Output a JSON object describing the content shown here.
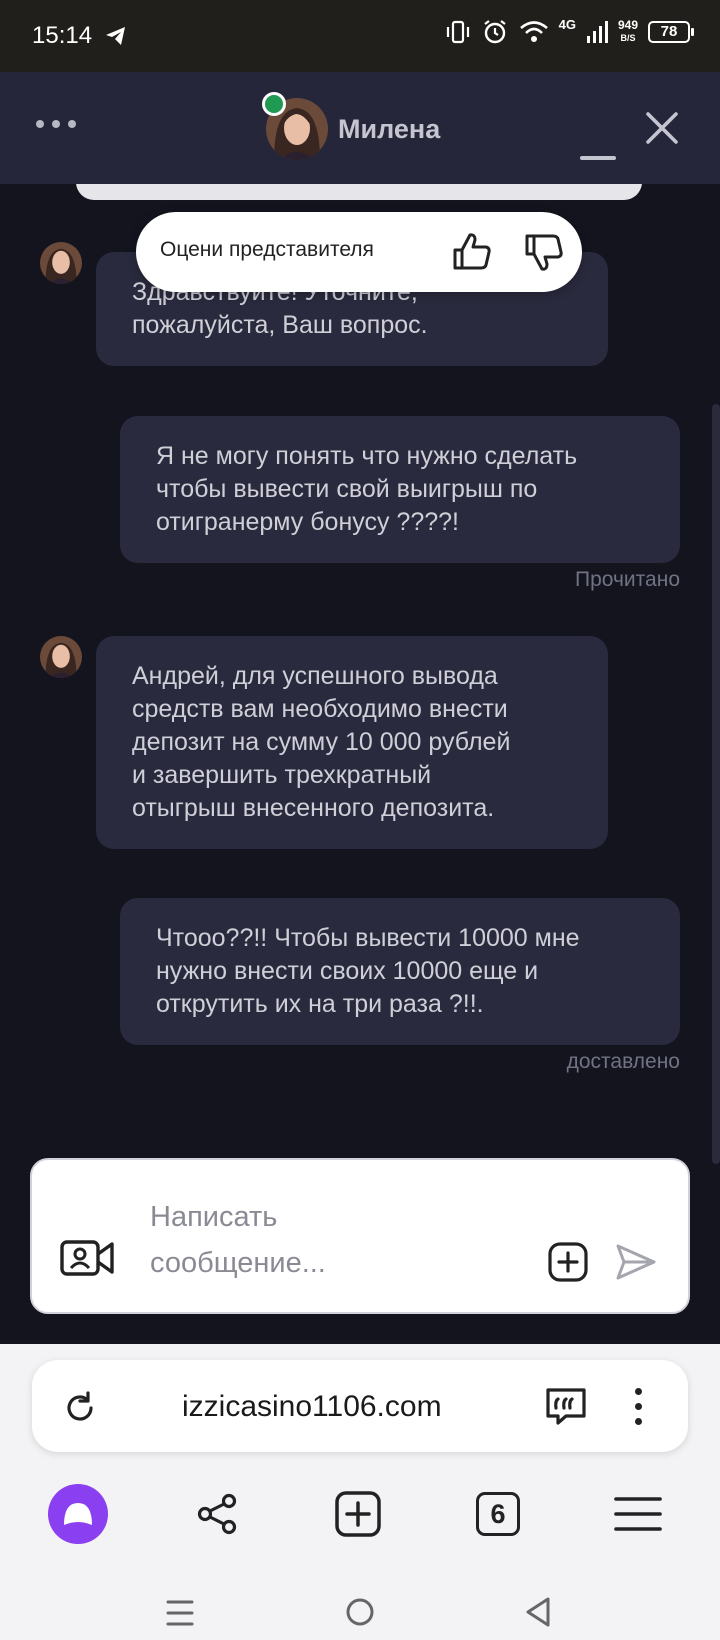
{
  "status_bar": {
    "time": "15:14",
    "net_speed": "949",
    "net_unit": "B/S",
    "network": "4G",
    "battery": "78",
    "icons": [
      "telegram-icon",
      "vibrate-icon",
      "alarm-icon",
      "wifi-icon",
      "signal-icon",
      "battery-icon"
    ]
  },
  "chat_header": {
    "agent_name": "Милена",
    "menu_icon": "more-dots-icon",
    "minimize_icon": "minimize-icon",
    "close_icon": "close-icon",
    "online_color": "#1f9a53"
  },
  "rating": {
    "label": "Оцени представителя",
    "like_icon": "thumbs-up-icon",
    "dislike_icon": "thumbs-down-icon"
  },
  "messages": [
    {
      "from": "agent",
      "text": "Здравствуйте! Уточните,\nпожалуйста, Ваш вопрос."
    },
    {
      "from": "user",
      "text": "Я не могу понять что нужно сделать\nчтобы вывести свой выигрыш по\nотигранерму бонусу ????!",
      "status": "Прочитано"
    },
    {
      "from": "agent",
      "text": "Андрей, для успешного вывода\nсредств вам необходимо внести\nдепозит на сумму 10 000 рублей\nи завершить трехкратный\nотыгрыш внесенного депозита."
    },
    {
      "from": "user",
      "text": "Чтооо??!! Чтобы вывести 10000 мне\nнужно внести своих 10000 еще и\nоткрутить их на три раза ?!!.",
      "status": "доставлено"
    }
  ],
  "composer": {
    "placeholder": "Написать\nсообщение...",
    "video_icon": "video-call-icon",
    "attach_icon": "add-attachment-icon",
    "send_icon": "send-icon"
  },
  "browser": {
    "url": "izzicasino1106.com",
    "tabs_count": "6",
    "icons": [
      "reload-icon",
      "quote-icon",
      "kebab-menu-icon",
      "alice-icon",
      "share-icon",
      "new-tab-icon",
      "tabs-icon",
      "hamburger-menu-icon"
    ]
  },
  "colors": {
    "chat_bg": "#14141f",
    "bubble_bg": "#2a2a3e",
    "header_bg": "#26263a",
    "alice_purple": "#8a3ff0"
  }
}
